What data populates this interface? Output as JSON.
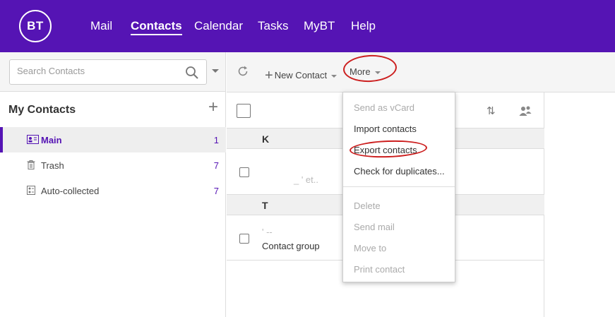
{
  "brand": {
    "logo_text": "BT",
    "color": "#5514b4"
  },
  "nav": [
    {
      "label": "Mail",
      "active": false
    },
    {
      "label": "Contacts",
      "active": true
    },
    {
      "label": "Calendar",
      "active": false
    },
    {
      "label": "Tasks",
      "active": false
    },
    {
      "label": "MyBT",
      "active": false
    },
    {
      "label": "Help",
      "active": false
    }
  ],
  "search": {
    "placeholder": "Search Contacts",
    "value": ""
  },
  "sidebar": {
    "title": "My Contacts",
    "add_icon": "plus-icon",
    "books": [
      {
        "label": "Main",
        "count": "1",
        "icon": "contact-card-icon",
        "active": true
      },
      {
        "label": "Trash",
        "count": "7",
        "icon": "trash-icon",
        "active": false
      },
      {
        "label": "Auto-collected",
        "count": "7",
        "icon": "collected-icon",
        "active": false
      }
    ]
  },
  "toolbar": {
    "refresh_icon": "refresh-icon",
    "new_contact_label": "New Contact",
    "more_label": "More"
  },
  "list": {
    "groups": [
      {
        "letter": "K",
        "rows": [
          {
            "line1": "",
            "line2": "_ ' et.."
          }
        ]
      },
      {
        "letter": "T",
        "rows": [
          {
            "line1": "' --",
            "line2": "Contact group"
          }
        ]
      }
    ]
  },
  "more_menu": {
    "items": [
      {
        "label": "Send as vCard",
        "enabled": false
      },
      {
        "label": "Import contacts",
        "enabled": true
      },
      {
        "label": "Export contacts",
        "enabled": true
      },
      {
        "label": "Check for duplicates...",
        "enabled": true
      },
      {
        "label": "Delete",
        "enabled": false
      },
      {
        "label": "Send mail",
        "enabled": false
      },
      {
        "label": "Move to",
        "enabled": false
      },
      {
        "label": "Print contact",
        "enabled": false
      }
    ]
  },
  "annotation_color": "#cc1f1f"
}
